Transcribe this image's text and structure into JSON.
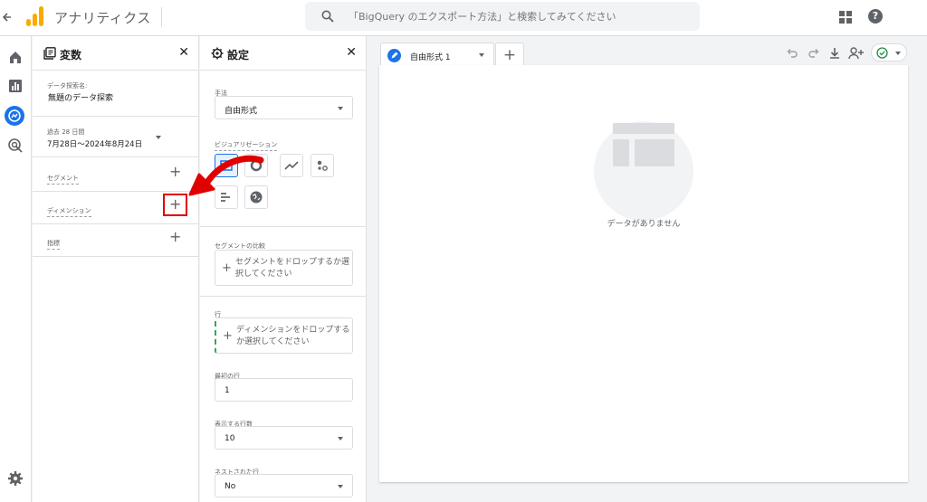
{
  "header": {
    "app_title": "アナリティクス",
    "search_placeholder": "「BigQuery のエクスポート方法」と検索してみてください"
  },
  "variables_panel": {
    "title": "変数",
    "exploration_name_label": "データ探索名:",
    "exploration_name": "無題のデータ探索",
    "date_range_badge": "過去 28 日間",
    "date_range": "7月28日～2024年8月24日",
    "segments_label": "セグメント",
    "dimensions_label": "ディメンション",
    "metrics_label": "指標"
  },
  "settings_panel": {
    "title": "設定",
    "technique_label": "手法",
    "technique_value": "自由形式",
    "visualization_label": "ビジュアリゼーション",
    "segment_compare_label": "セグメントの比較",
    "segment_drop_text": "セグメントをドロップするか選択してください",
    "rows_label": "行",
    "rows_drop_text": "ディメンションをドロップするか選択してください",
    "first_row_label": "最初の行",
    "first_row_value": "1",
    "show_rows_label": "表示する行数",
    "show_rows_value": "10",
    "nested_rows_label": "ネストされた行",
    "nested_rows_value": "No"
  },
  "canvas": {
    "tab_label": "自由形式 1",
    "empty_message": "データがありません"
  },
  "colors": {
    "accent": "#1a73e8",
    "annotation": "#e00000",
    "logo": "#f9ab00"
  }
}
